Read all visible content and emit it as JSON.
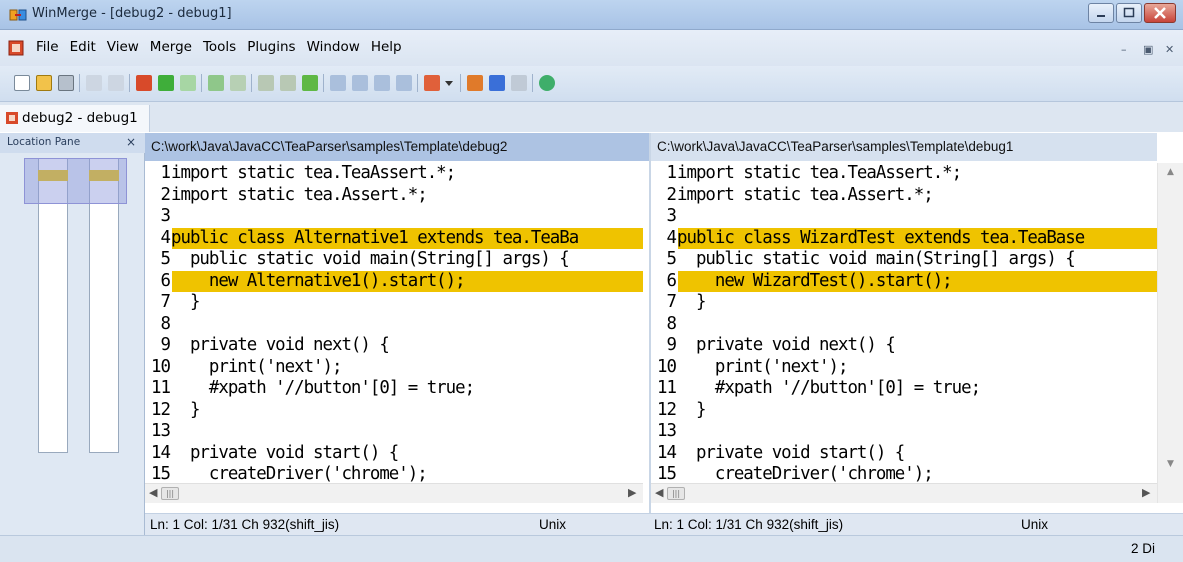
{
  "window": {
    "title": "WinMerge - [debug2 - debug1]"
  },
  "menu": {
    "items": [
      "File",
      "Edit",
      "View",
      "Merge",
      "Tools",
      "Plugins",
      "Window",
      "Help"
    ]
  },
  "tab": {
    "label": "debug2 - debug1"
  },
  "location_pane": {
    "title": "Location Pane",
    "close": "×"
  },
  "left_pane": {
    "path": "C:\\work\\Java\\JavaCC\\TeaParser\\samples\\Template\\debug2",
    "lines": [
      {
        "n": "1",
        "text": "import static tea.TeaAssert.*;",
        "diff": false
      },
      {
        "n": "2",
        "text": "import static tea.Assert.*;",
        "diff": false
      },
      {
        "n": "3",
        "text": "",
        "diff": false
      },
      {
        "n": "4",
        "text": "public class Alternative1 extends tea.TeaBa",
        "diff": true
      },
      {
        "n": "5",
        "text": "  public static void main(String[] args) {",
        "diff": false
      },
      {
        "n": "6",
        "text": "    new Alternative1().start();",
        "diff": true
      },
      {
        "n": "7",
        "text": "  }",
        "diff": false
      },
      {
        "n": "8",
        "text": "",
        "diff": false
      },
      {
        "n": "9",
        "text": "  private void next() {",
        "diff": false
      },
      {
        "n": "10",
        "text": "    print('next');",
        "diff": false
      },
      {
        "n": "11",
        "text": "    #xpath '//button'[0] = true;",
        "diff": false
      },
      {
        "n": "12",
        "text": "  }",
        "diff": false
      },
      {
        "n": "13",
        "text": "",
        "diff": false
      },
      {
        "n": "14",
        "text": "  private void start() {",
        "diff": false
      },
      {
        "n": "15",
        "text": "    createDriver('chrome');",
        "diff": false
      }
    ],
    "status": {
      "position": "Ln: 1  Col: 1/31  Ch 932(shift_jis)",
      "eol": "Unix"
    }
  },
  "right_pane": {
    "path": "C:\\work\\Java\\JavaCC\\TeaParser\\samples\\Template\\debug1",
    "lines": [
      {
        "n": "1",
        "text": "import static tea.TeaAssert.*;",
        "diff": false
      },
      {
        "n": "2",
        "text": "import static tea.Assert.*;",
        "diff": false
      },
      {
        "n": "3",
        "text": "",
        "diff": false
      },
      {
        "n": "4",
        "text": "public class WizardTest extends tea.TeaBase",
        "diff": true
      },
      {
        "n": "5",
        "text": "  public static void main(String[] args) {",
        "diff": false
      },
      {
        "n": "6",
        "text": "    new WizardTest().start();",
        "diff": true
      },
      {
        "n": "7",
        "text": "  }",
        "diff": false
      },
      {
        "n": "8",
        "text": "",
        "diff": false
      },
      {
        "n": "9",
        "text": "  private void next() {",
        "diff": false
      },
      {
        "n": "10",
        "text": "    print('next');",
        "diff": false
      },
      {
        "n": "11",
        "text": "    #xpath '//button'[0] = true;",
        "diff": false
      },
      {
        "n": "12",
        "text": "  }",
        "diff": false
      },
      {
        "n": "13",
        "text": "",
        "diff": false
      },
      {
        "n": "14",
        "text": "  private void start() {",
        "diff": false
      },
      {
        "n": "15",
        "text": "    createDriver('chrome');",
        "diff": false
      }
    ],
    "status": {
      "position": "Ln: 1  Col: 1/31  Ch 932(shift_jis)",
      "eol": "Unix"
    }
  },
  "statusbar": {
    "count": "2 Di"
  },
  "colors": {
    "diff_highlight": "#efc300",
    "active_header": "#adc3e3",
    "inactive_header": "#d6e1ef"
  }
}
